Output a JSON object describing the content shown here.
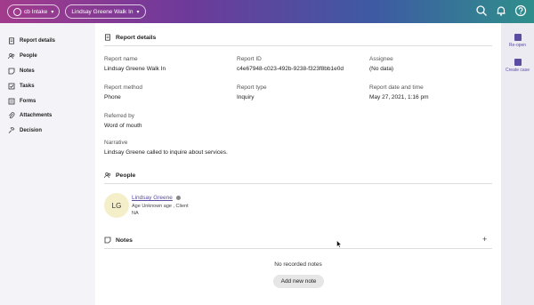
{
  "topbar": {
    "intake_label": "cb Intake",
    "report_label": "Lindsay Greene Walk In",
    "icons": [
      "search-icon",
      "bell-icon",
      "help-icon"
    ]
  },
  "sidebar": {
    "items": [
      {
        "label": "Report details",
        "icon": "document-icon"
      },
      {
        "label": "People",
        "icon": "people-icon"
      },
      {
        "label": "Notes",
        "icon": "note-icon"
      },
      {
        "label": "Tasks",
        "icon": "checkbox-icon"
      },
      {
        "label": "Forms",
        "icon": "form-icon"
      },
      {
        "label": "Attachments",
        "icon": "paperclip-icon"
      },
      {
        "label": "Decision",
        "icon": "gavel-icon"
      }
    ]
  },
  "report_details": {
    "title": "Report details",
    "fields": {
      "report_name": {
        "label": "Report name",
        "value": "Lindsay Greene Walk In"
      },
      "report_id": {
        "label": "Report ID",
        "value": "c4e67948-c023-492b-9238-f323f8bb1e0d"
      },
      "assignee": {
        "label": "Assignee",
        "value": "(No data)"
      },
      "report_method": {
        "label": "Report method",
        "value": "Phone"
      },
      "report_type": {
        "label": "Report type",
        "value": "Inquiry"
      },
      "report_date": {
        "label": "Report date and time",
        "value": "May 27, 2021, 1:16 pm"
      },
      "referred_by": {
        "label": "Referred by",
        "value": "Word of mouth"
      },
      "narrative": {
        "label": "Narrative",
        "value": "Lindsay Greene called to inquire about services."
      }
    }
  },
  "people": {
    "title": "People",
    "person": {
      "initials": "LG",
      "name": "Lindsay Greene",
      "meta1": "Age Unknown age , Client",
      "meta2": "NA"
    }
  },
  "notes": {
    "title": "Notes",
    "add_symbol": "+",
    "empty_text": "No recorded notes",
    "add_button": "Add new note"
  },
  "right_rail": {
    "reopen": "Re-open",
    "create_case": "Create case"
  },
  "colors": {
    "accent": "#5b4ea2",
    "avatar_bg": "#f5efc9"
  }
}
